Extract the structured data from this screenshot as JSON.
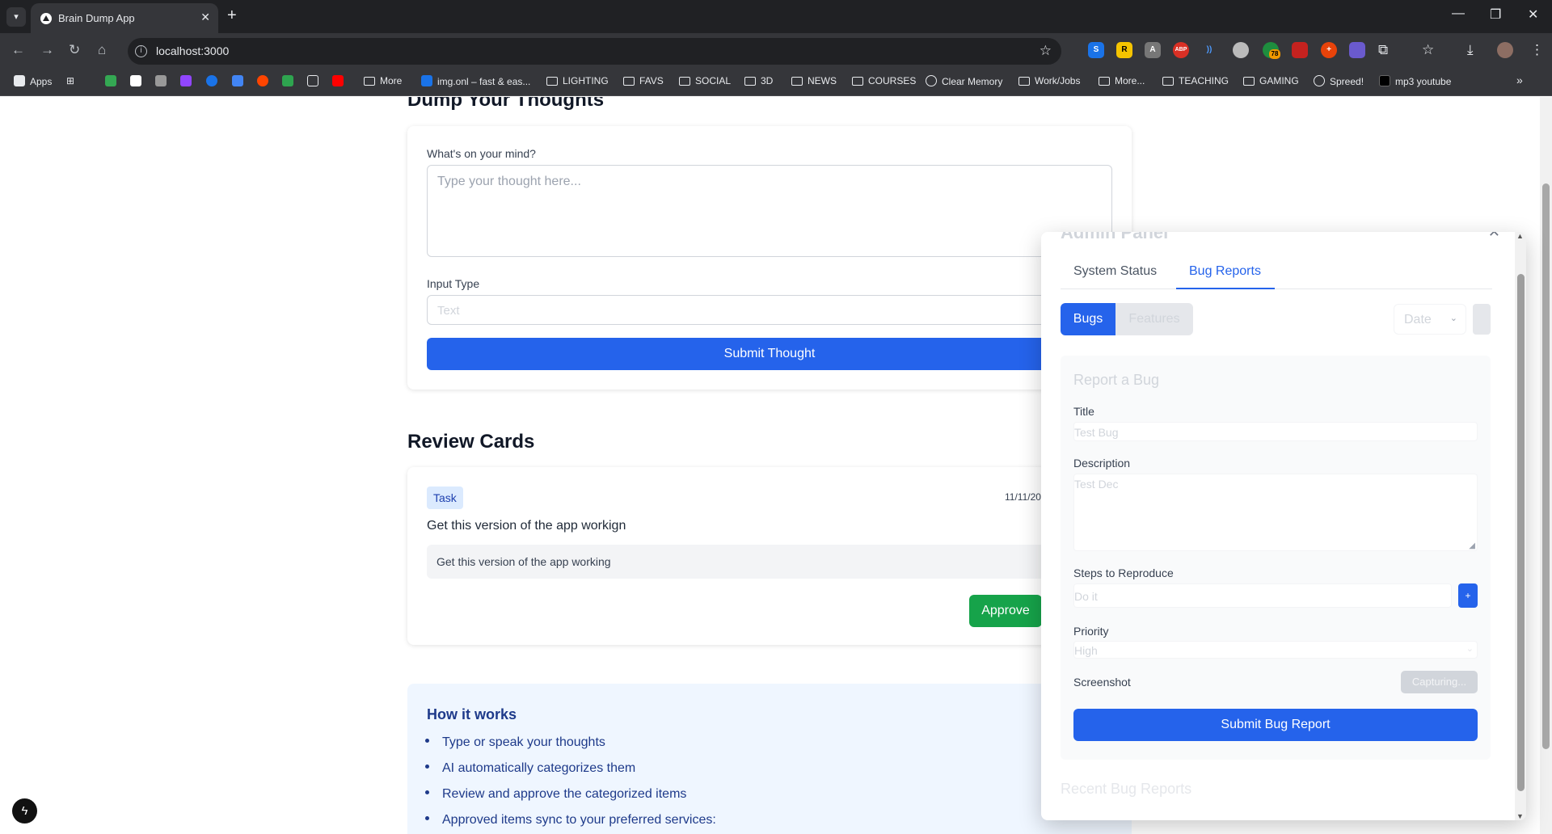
{
  "browser": {
    "tab_title": "Brain Dump App",
    "url": "localhost:3000",
    "bookmarks": [
      "Apps",
      "More",
      "img.onl – fast & eas...",
      "LIGHTING",
      "FAVS",
      "SOCIAL",
      "3D",
      "NEWS",
      "COURSES",
      "Clear Memory",
      "Work/Jobs",
      "More...",
      "TEACHING",
      "GAMING",
      "Spreed!",
      "mp3 youtube"
    ],
    "ext_badge": "78"
  },
  "dump": {
    "heading": "Dump Your Thoughts",
    "mind_label": "What's on your mind?",
    "thought_placeholder": "Type your thought here...",
    "input_type_label": "Input Type",
    "input_type_value": "Text",
    "submit_label": "Submit Thought"
  },
  "review": {
    "heading": "Review Cards",
    "card": {
      "tag": "Task",
      "date": "11/11/20",
      "title": "Get this version of the app workign",
      "body": "Get this version of the app working",
      "approve_label": "Approve"
    }
  },
  "how": {
    "heading": "How it works",
    "items": [
      "Type or speak your thoughts",
      "AI automatically categorizes them",
      "Review and approve the categorized items",
      "Approved items sync to your preferred services:"
    ]
  },
  "admin": {
    "title": "Admin Panel",
    "tabs": [
      "System Status",
      "Bug Reports"
    ],
    "segments": [
      "Bugs",
      "Features"
    ],
    "sort_value": "Date",
    "form": {
      "heading": "Report a Bug",
      "title_label": "Title",
      "title_value": "Test Bug",
      "desc_label": "Description",
      "desc_value": "Test Dec",
      "steps_label": "Steps to Reproduce",
      "steps_value": "Do it",
      "add_step_label": "+",
      "priority_label": "Priority",
      "priority_value": "High",
      "screenshot_label": "Screenshot",
      "capture_label": "Capturing...",
      "submit_label": "Submit Bug Report"
    },
    "recent_heading": "Recent Bug Reports"
  },
  "colors": {
    "primary": "#2563eb",
    "approve": "#16a34a",
    "tag_bg": "#dbeafe"
  }
}
